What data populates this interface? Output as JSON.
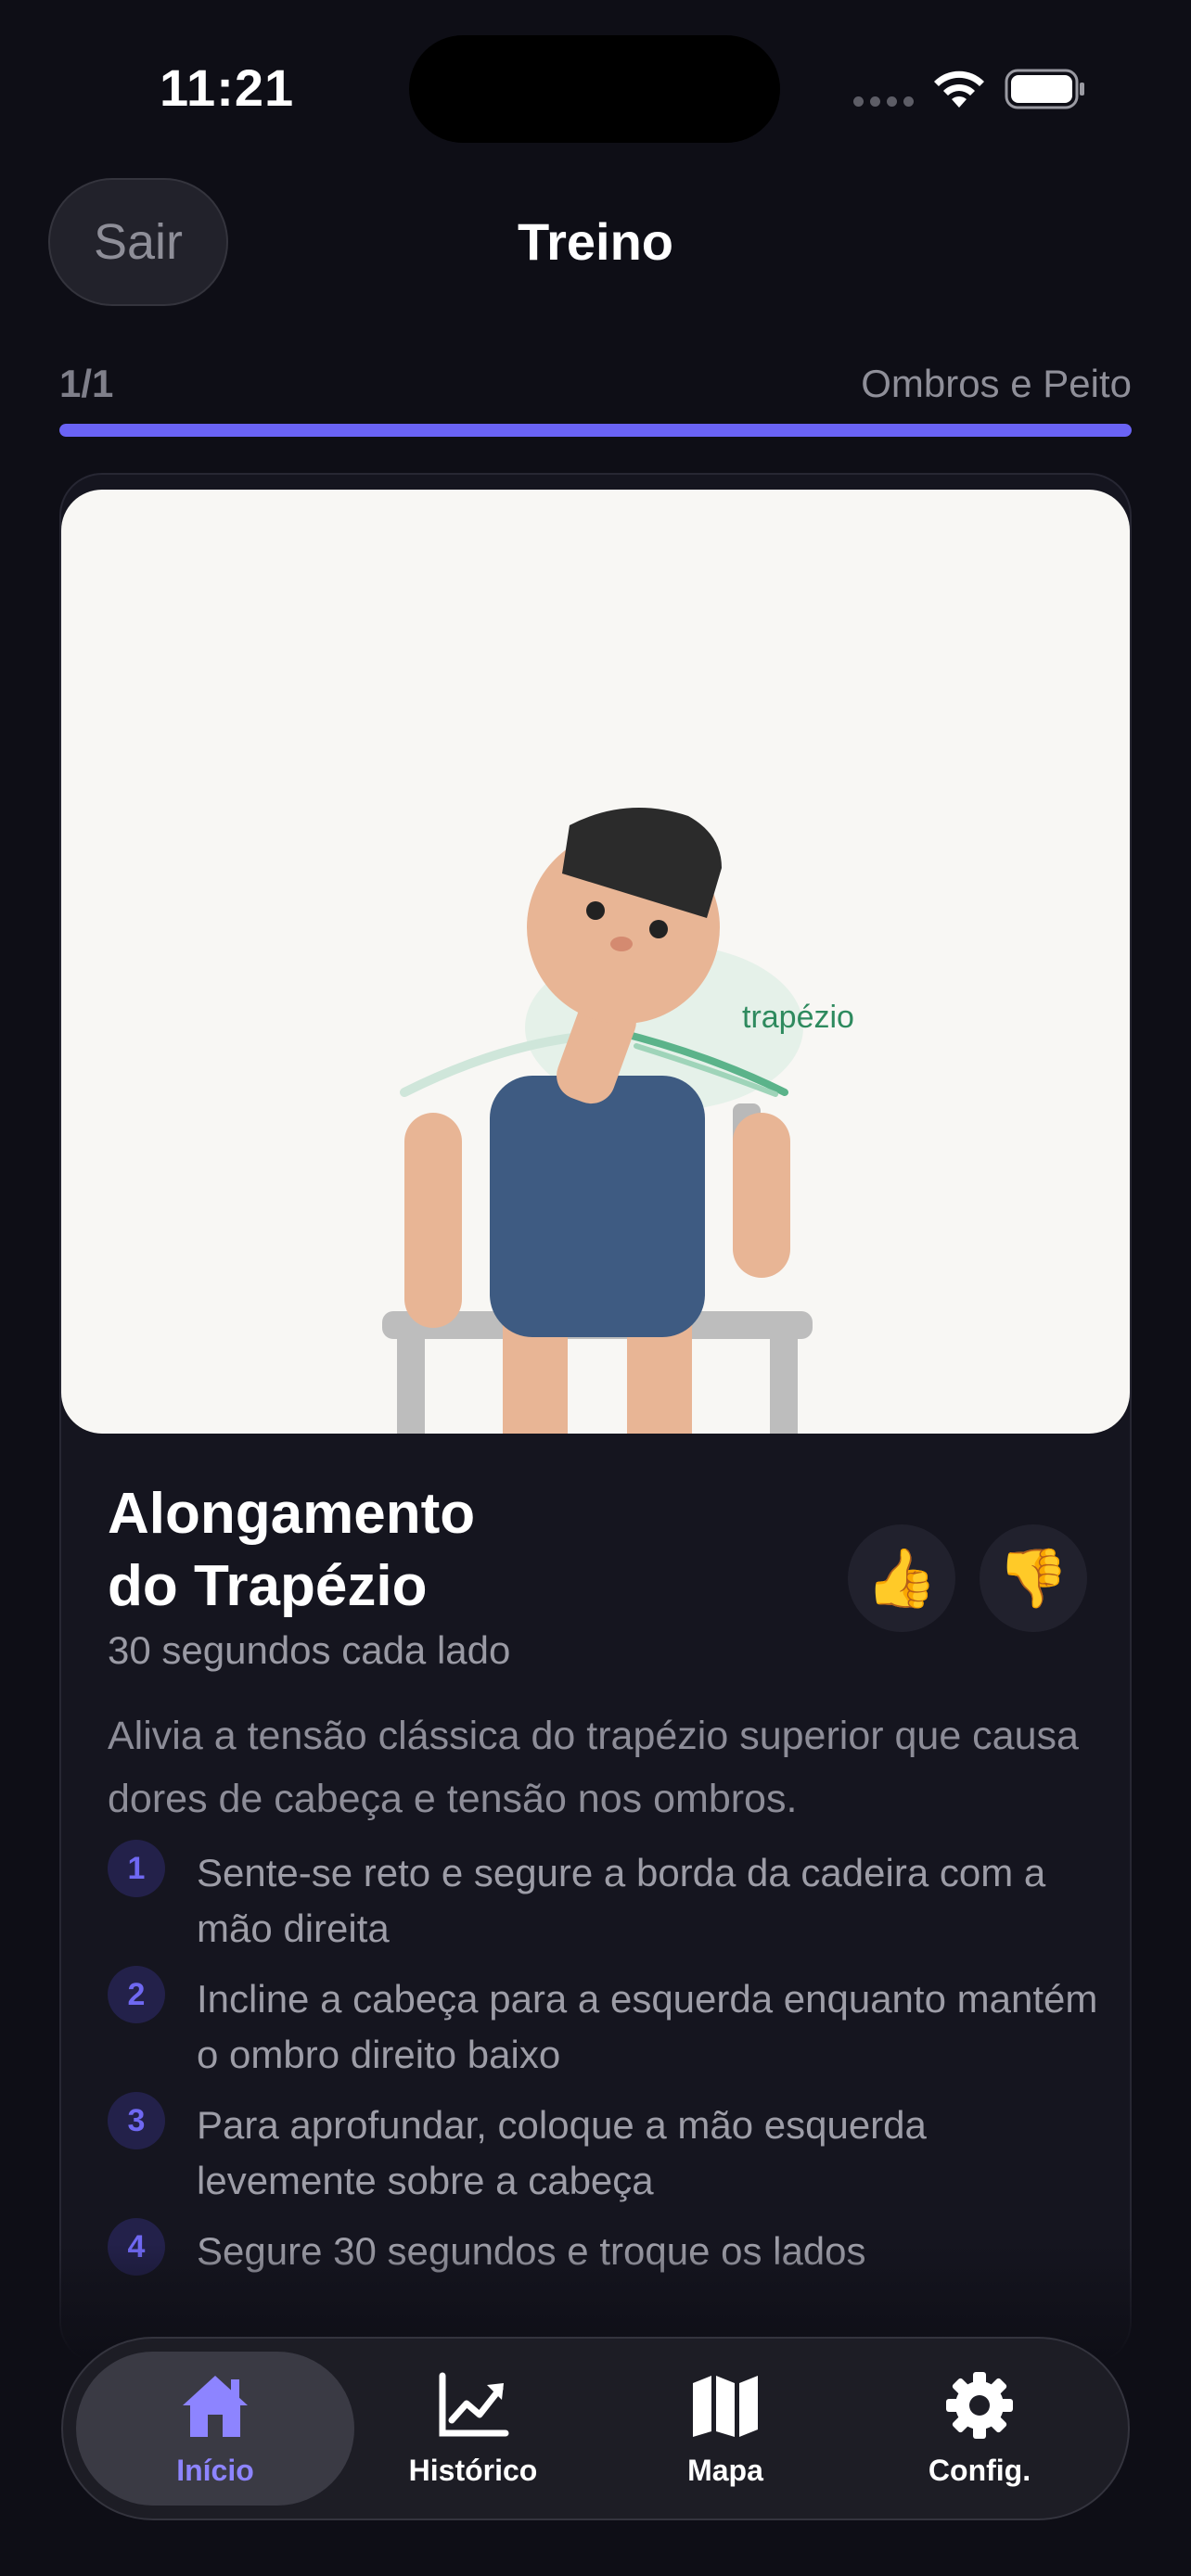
{
  "status_bar": {
    "time": "11:21"
  },
  "header": {
    "exit_label": "Sair",
    "title": "Treino"
  },
  "progress": {
    "count": "1/1",
    "category": "Ombros e Peito",
    "fraction": 1.0
  },
  "illustration": {
    "muscle_label": "trapézio"
  },
  "exercise": {
    "title_line1": "Alongamento",
    "title_line2": "do Trapézio",
    "duration": "30 segundos cada lado",
    "description": "Alivia a tensão clássica do trapézio superior que causa dores de cabeça e tensão nos ombros.",
    "thumbs_up": "👍",
    "thumbs_down": "👎",
    "steps": [
      {
        "number": "1",
        "text": "Sente-se reto e segure a borda da cadeira com a mão direita"
      },
      {
        "number": "2",
        "text": "Incline a cabeça para a esquerda enquanto mantém o ombro direito baixo"
      },
      {
        "number": "3",
        "text": "Para aprofundar, coloque a mão esquerda levemente sobre a cabeça"
      },
      {
        "number": "4",
        "text": "Segure 30 segundos e troque os lados"
      }
    ]
  },
  "tabbar": {
    "items": [
      {
        "label": "Início",
        "icon": "house-icon",
        "active": true
      },
      {
        "label": "Histórico",
        "icon": "chart-line-icon",
        "active": false
      },
      {
        "label": "Mapa",
        "icon": "map-icon",
        "active": false
      },
      {
        "label": "Config.",
        "icon": "gear-icon",
        "active": false
      }
    ]
  },
  "colors": {
    "background": "#0e0e16",
    "accent": "#6a63f5",
    "card": "#15151f",
    "illustration_bg": "#f8f7f4",
    "muscle_highlight": "#2e8a5e"
  }
}
